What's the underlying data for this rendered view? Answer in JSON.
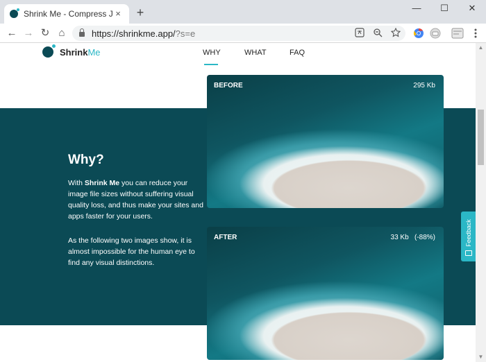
{
  "browser": {
    "tab_title": "Shrink Me - Compress JPG, PNG",
    "tab_close": "×",
    "new_tab": "+",
    "window_controls": {
      "minimize": "—",
      "maximize": "☐",
      "close": "✕"
    },
    "nav": {
      "back": "←",
      "forward": "→",
      "reload": "↻",
      "home": "⌂"
    },
    "url_main": "https://shrinkme.app/",
    "url_rest": "?s=e",
    "omnibox_icons": [
      "translate-icon",
      "zoom-icon",
      "star-icon"
    ],
    "extension_icons": [
      "chrome-ext-icon",
      "ext-icon",
      "profile-icon",
      "menu-icon"
    ]
  },
  "site": {
    "logo": {
      "strong": "Shrink",
      "light": "Me"
    },
    "menu": [
      {
        "label": "WHY",
        "active": true
      },
      {
        "label": "WHAT",
        "active": false
      },
      {
        "label": "FAQ",
        "active": false
      }
    ],
    "why": {
      "title": "Why?",
      "p1_pre": "With ",
      "p1_bold": "Shrink Me",
      "p1_post": " you can reduce your image file sizes without suffering visual quality loss, and thus make your sites and apps faster for your users.",
      "p2": "As the following two images show, it is almost impossible for the human eye to find any visual distinctions."
    },
    "before_card": {
      "label": "BEFORE",
      "size": "295 Kb"
    },
    "after_card": {
      "label": "AFTER",
      "size": "33 Kb   (-88%)"
    },
    "feedback": "Feedback"
  },
  "colors": {
    "brand_dark": "#0b4a55",
    "brand_accent": "#2bb7c6",
    "chrome_bg": "#dee1e6"
  }
}
